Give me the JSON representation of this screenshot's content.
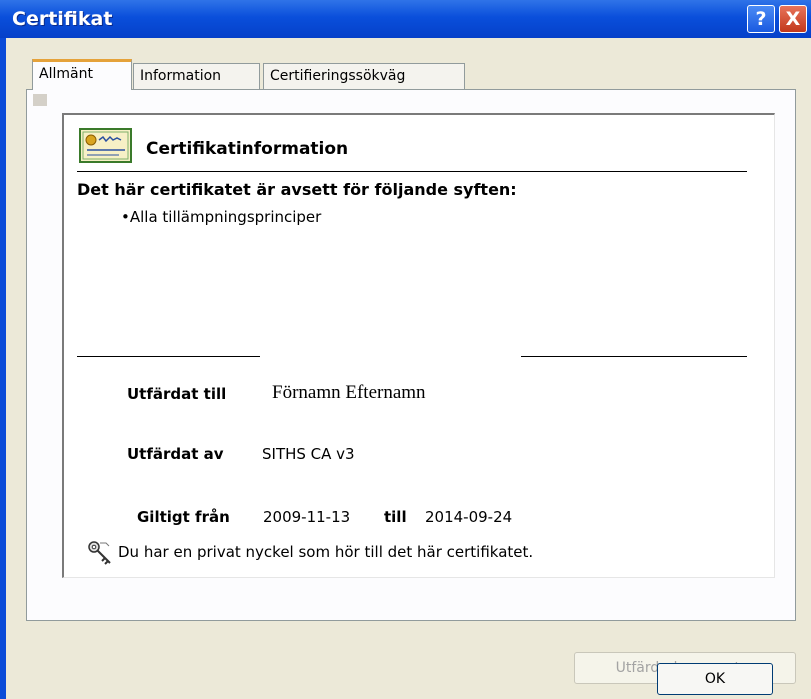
{
  "window": {
    "title": "Certifikat"
  },
  "controls": {
    "help": "?",
    "close": "X"
  },
  "tabs": [
    {
      "label": "Allmänt",
      "active": true
    },
    {
      "label": "Information",
      "active": false
    },
    {
      "label": "Certifieringssökväg",
      "active": false
    }
  ],
  "info": {
    "heading": "Certifikatinformation",
    "purpose_title": "Det här certifikatet är avsett för följande syften:",
    "purpose_item": "•Alla tillämpningsprinciper",
    "issued_to_label": "Utfärdat till",
    "issued_to_value": "Förnamn Efternamn",
    "issued_by_label": "Utfärdat av",
    "issued_by_value": "SITHS CA v3",
    "valid_from_label": "Giltigt från",
    "valid_from_value": "2009-11-13",
    "valid_to_label": "till",
    "valid_to_value": "2014-09-24",
    "private_key_text": "Du har en privat nyckel som hör till det här certifikatet."
  },
  "buttons": {
    "issuer_statement": "Utfärdarkommentar",
    "ok": "OK"
  },
  "icons": {
    "certificate": "certificate-icon",
    "key": "key-icon"
  },
  "colors": {
    "titlebar": "#0a4fdb",
    "dialog_bg": "#ece9d8",
    "tab_highlight": "#e5a23a"
  }
}
